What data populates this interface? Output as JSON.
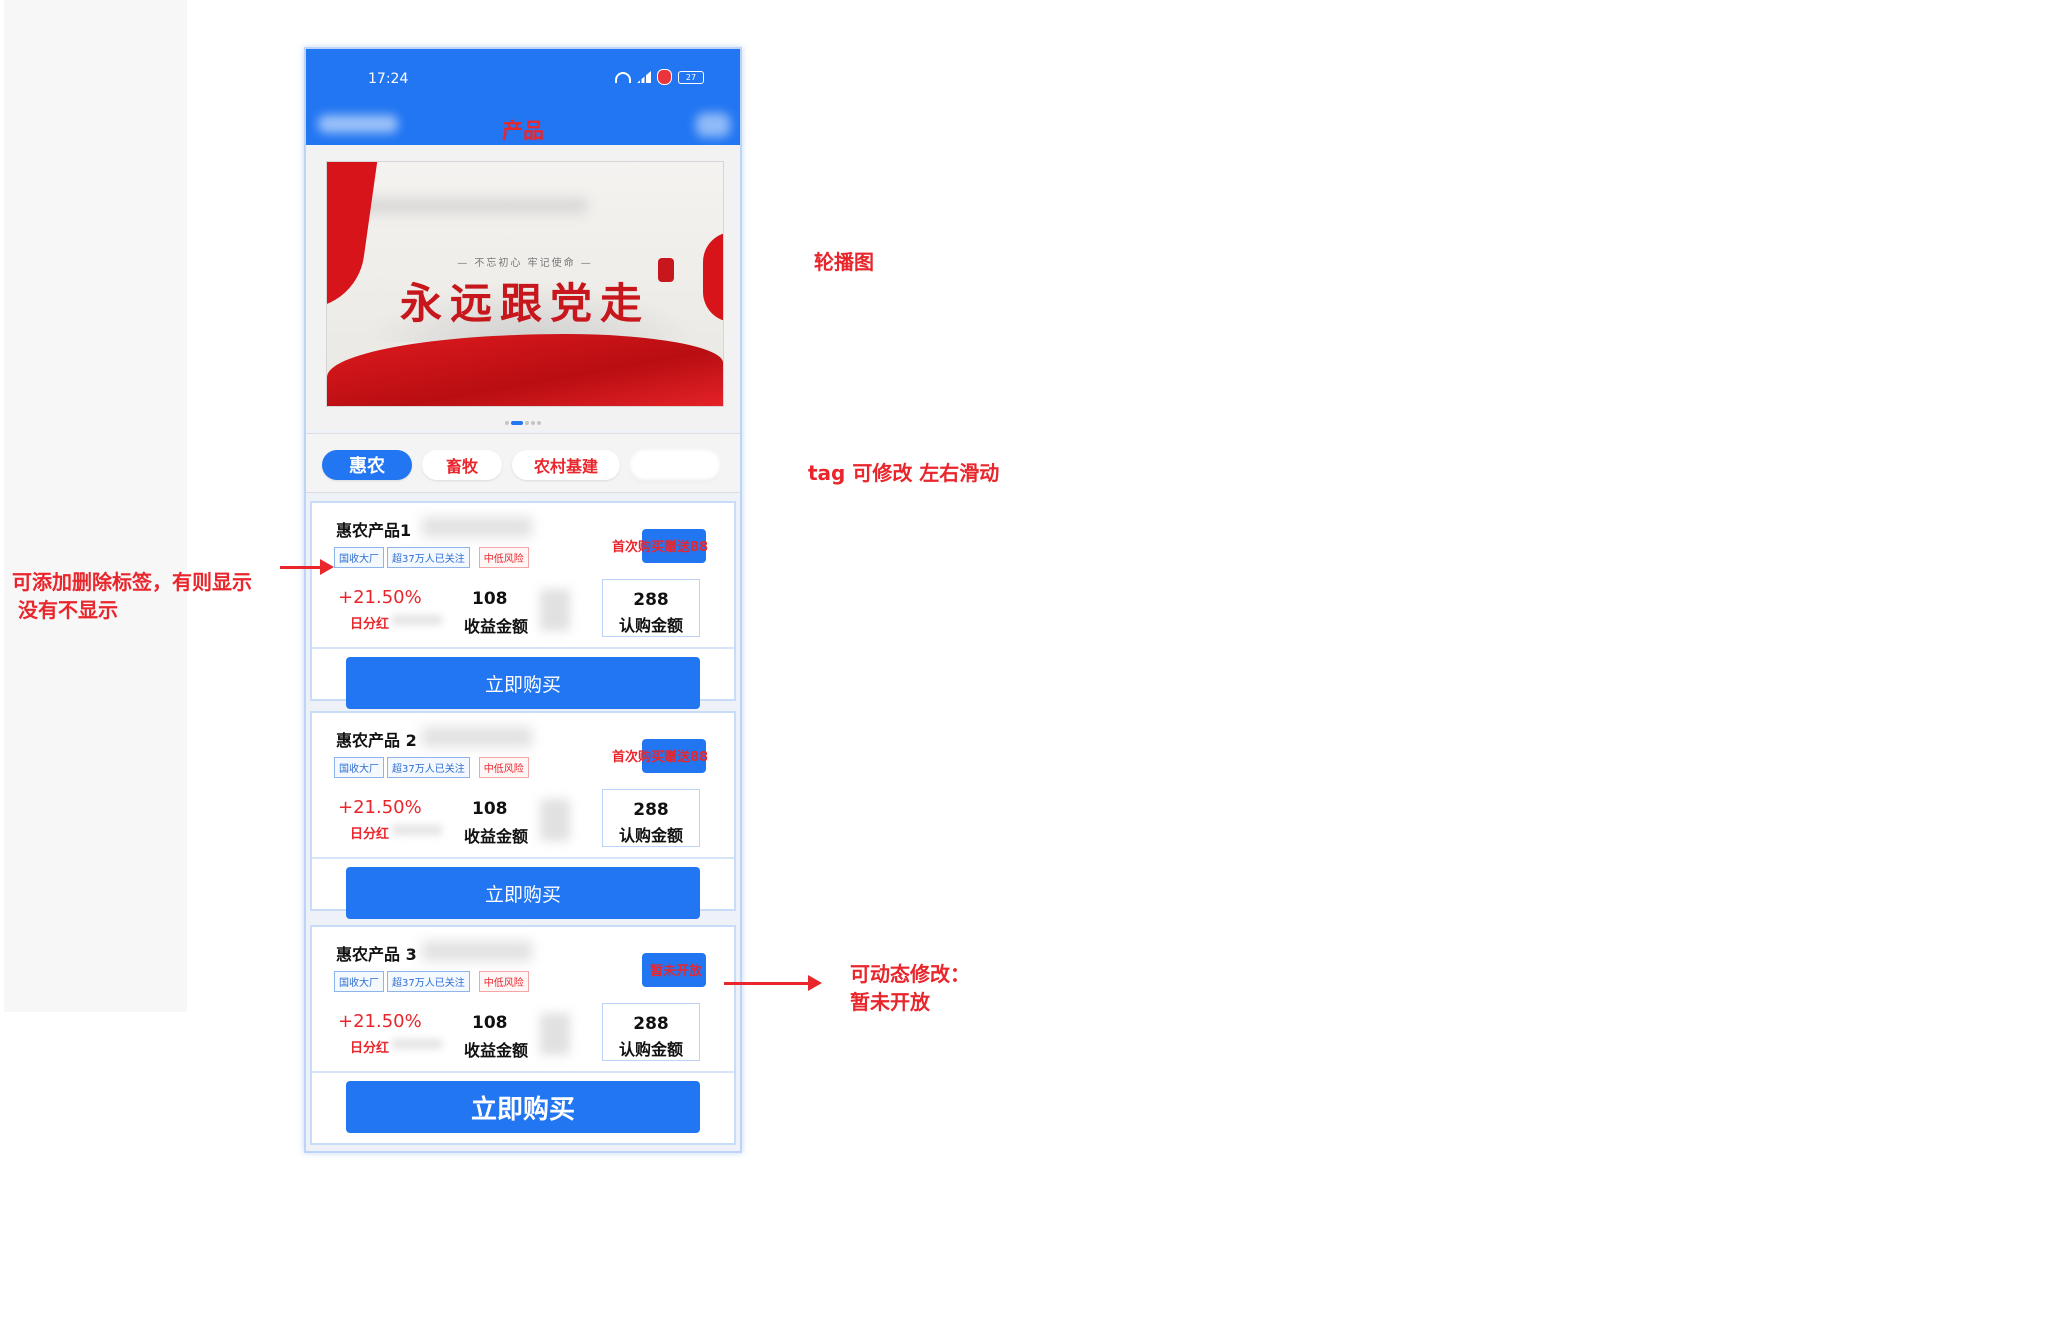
{
  "status": {
    "time": "17:24",
    "battery": "27"
  },
  "header": {
    "title": "产品"
  },
  "banner": {
    "slogan_small": "— 不忘初心  牢记使命 —",
    "slogan": "永远跟党走"
  },
  "tabs": [
    {
      "label": "惠农",
      "active": true
    },
    {
      "label": "畜牧",
      "active": false
    },
    {
      "label": "农村基建",
      "active": false
    },
    {
      "label": "",
      "active": false
    }
  ],
  "cards": [
    {
      "name": "惠农产品1",
      "tags": [
        "国收大厂",
        "超37万人已关注"
      ],
      "risk_tag": "中低风险",
      "promo": "首次购买赠送88",
      "rate": "+21.50%",
      "rate_label": "日分红",
      "income_value": "108",
      "income_label": "收益金额",
      "sub_value": "288",
      "sub_label": "认购金额",
      "buy_label": "立即购买"
    },
    {
      "name": "惠农产品 2",
      "tags": [
        "国收大厂",
        "超37万人已关注"
      ],
      "risk_tag": "中低风险",
      "promo": "首次购买赠送88",
      "rate": "+21.50%",
      "rate_label": "日分红",
      "income_value": "108",
      "income_label": "收益金额",
      "sub_value": "288",
      "sub_label": "认购金额",
      "buy_label": "立即购买"
    },
    {
      "name": "惠农产品 3",
      "tags": [
        "国收大厂",
        "超37万人已关注"
      ],
      "risk_tag": "中低风险",
      "promo": "暂未开放",
      "rate": "+21.50%",
      "rate_label": "日分红",
      "income_value": "108",
      "income_label": "收益金额",
      "sub_value": "288",
      "sub_label": "认购金额",
      "buy_label": "立即购买"
    }
  ],
  "annotations": {
    "banner_note": "轮播图",
    "tag_note": "tag  可修改  左右滑动",
    "label_note_line1": "可添加删除标签，有则显示",
    "label_note_line2": "没有不显示",
    "dynamic_note_line1": "可动态修改：",
    "dynamic_note_line2": "暂未开放"
  },
  "colors": {
    "primary": "#2276f2",
    "accent_red": "#e8262c"
  }
}
